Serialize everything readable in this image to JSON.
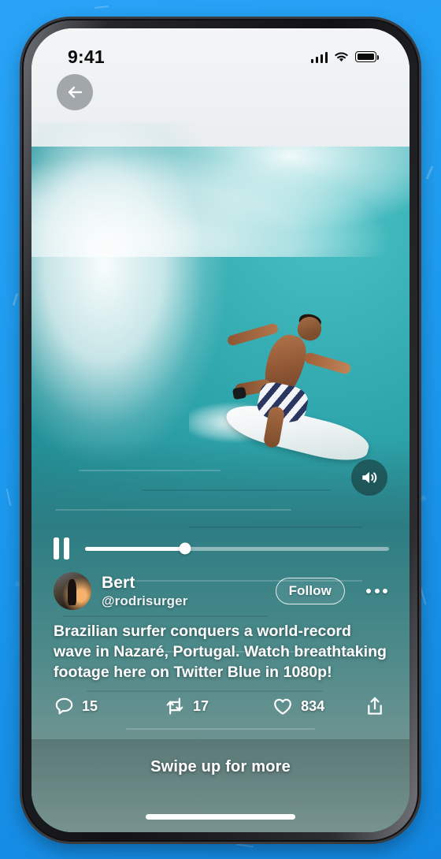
{
  "theme": {
    "backdrop_color": "#1d9bf0",
    "accent_color": "#ffffff",
    "phone_frame_color": "#101012"
  },
  "status_bar": {
    "time": "9:41",
    "cellular_icon": "signal-bars-icon",
    "wifi_icon": "wifi-icon",
    "battery_icon": "battery-full-icon"
  },
  "nav": {
    "back_icon": "arrow-left-icon"
  },
  "player": {
    "state_icon": "pause-icon",
    "progress_percent": 33,
    "volume_icon": "speaker-on-icon"
  },
  "post": {
    "display_name": "Bert",
    "handle": "@rodrisurger",
    "avatar_icon": "user-avatar",
    "follow_label": "Follow",
    "more_icon": "more-horizontal-icon",
    "caption": "Brazilian surfer conquers a world-record wave in Nazaré, Portugal. Watch breathtaking footage here on Twitter Blue in 1080p!"
  },
  "actions": [
    {
      "name": "reply",
      "icon": "comment-icon",
      "count": "15"
    },
    {
      "name": "retweet",
      "icon": "retweet-icon",
      "count": "17"
    },
    {
      "name": "like",
      "icon": "heart-icon",
      "count": "834"
    },
    {
      "name": "share",
      "icon": "share-upload-icon",
      "count": ""
    }
  ],
  "next_video": {
    "swipe_label": "Swipe up for more"
  }
}
